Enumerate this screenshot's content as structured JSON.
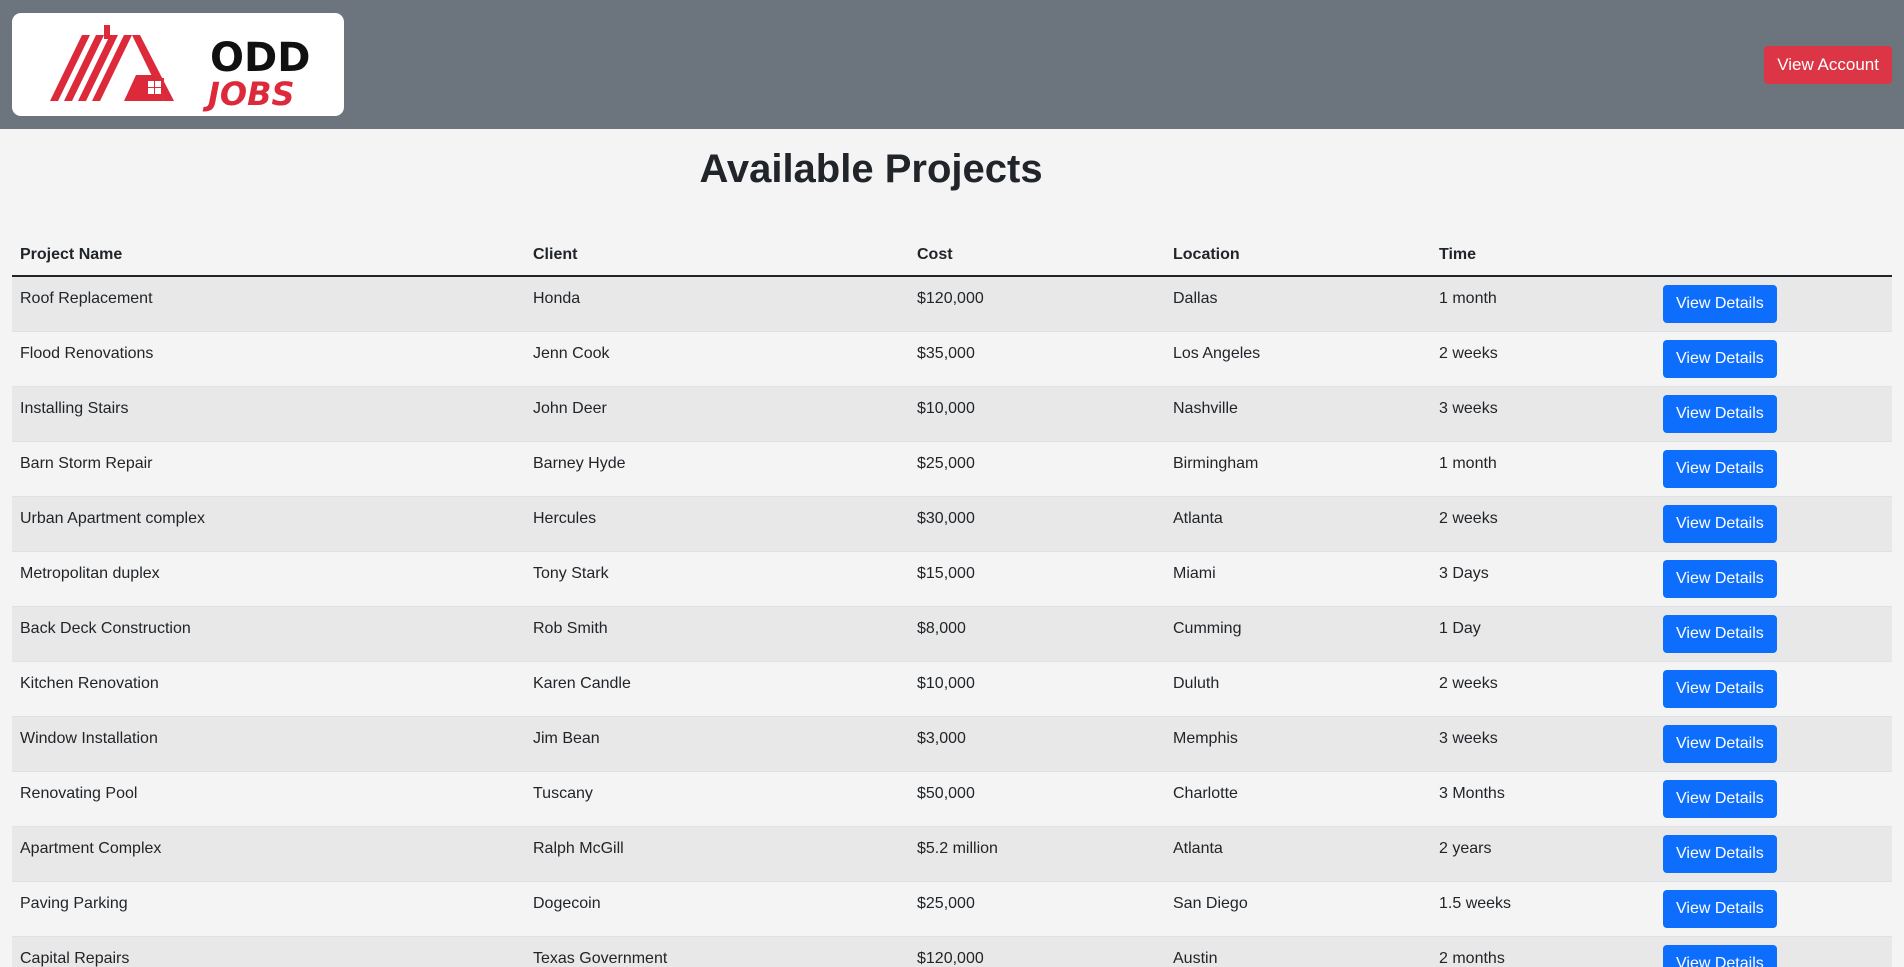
{
  "brand": {
    "logo_top": "ODD",
    "logo_bottom": "JOBS"
  },
  "header": {
    "account_label": "View Account"
  },
  "page": {
    "title": "Available Projects"
  },
  "table": {
    "columns": [
      "Project Name",
      "Client",
      "Cost",
      "Location",
      "Time",
      ""
    ],
    "action_label": "View Details",
    "rows": [
      {
        "project": "Roof Replacement",
        "client": "Honda",
        "cost": "$120,000",
        "location": "Dallas",
        "time": "1 month"
      },
      {
        "project": "Flood Renovations",
        "client": "Jenn Cook",
        "cost": "$35,000",
        "location": "Los Angeles",
        "time": "2 weeks"
      },
      {
        "project": "Installing Stairs",
        "client": "John Deer",
        "cost": "$10,000",
        "location": "Nashville",
        "time": "3 weeks"
      },
      {
        "project": "Barn Storm Repair",
        "client": "Barney Hyde",
        "cost": "$25,000",
        "location": "Birmingham",
        "time": "1 month"
      },
      {
        "project": "Urban Apartment complex",
        "client": "Hercules",
        "cost": "$30,000",
        "location": "Atlanta",
        "time": "2 weeks"
      },
      {
        "project": "Metropolitan duplex",
        "client": "Tony Stark",
        "cost": "$15,000",
        "location": "Miami",
        "time": "3 Days"
      },
      {
        "project": "Back Deck Construction",
        "client": "Rob Smith",
        "cost": "$8,000",
        "location": "Cumming",
        "time": "1 Day"
      },
      {
        "project": "Kitchen Renovation",
        "client": "Karen Candle",
        "cost": "$10,000",
        "location": "Duluth",
        "time": "2 weeks"
      },
      {
        "project": "Window Installation",
        "client": "Jim Bean",
        "cost": "$3,000",
        "location": "Memphis",
        "time": "3 weeks"
      },
      {
        "project": "Renovating Pool",
        "client": "Tuscany",
        "cost": "$50,000",
        "location": "Charlotte",
        "time": "3 Months"
      },
      {
        "project": "Apartment Complex",
        "client": "Ralph McGill",
        "cost": "$5.2 million",
        "location": "Atlanta",
        "time": "2 years"
      },
      {
        "project": "Paving Parking",
        "client": "Dogecoin",
        "cost": "$25,000",
        "location": "San Diego",
        "time": "1.5 weeks"
      },
      {
        "project": "Capital Repairs",
        "client": "Texas Government",
        "cost": "$120,000",
        "location": "Austin",
        "time": "2 months"
      }
    ]
  },
  "colors": {
    "topbar": "#6c757d",
    "account_button": "#dc3545",
    "details_button": "#0d6efd",
    "logo_red": "#dc2a3b"
  },
  "icons": {
    "logo": "house-roof-logo"
  }
}
